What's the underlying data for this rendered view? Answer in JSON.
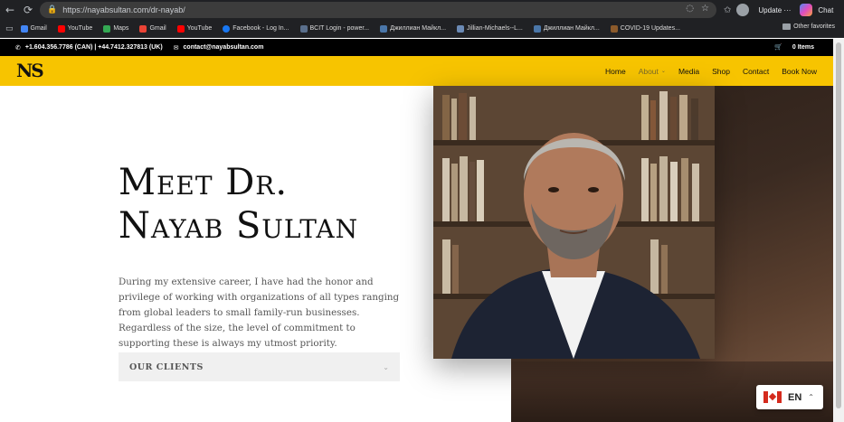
{
  "browser": {
    "url": "https://nayabsultan.com/dr-nayab/",
    "update_label": "Update",
    "chat_label": "Chat",
    "bookmarks": [
      {
        "label": "Gmail",
        "color": "#4285f4"
      },
      {
        "label": "YouTube",
        "color": "#ff0000"
      },
      {
        "label": "Maps",
        "color": "#34a853"
      },
      {
        "label": "Gmail",
        "color": "#ea4335"
      },
      {
        "label": "YouTube",
        "color": "#ff0000"
      },
      {
        "label": "Facebook - Log In...",
        "color": "#1877f2"
      },
      {
        "label": "BCIT Login - power...",
        "color": "#5a6f8c"
      },
      {
        "label": "Джиллиан Майкл...",
        "color": "#4a76a8"
      },
      {
        "label": "Jillian-Michaels--L...",
        "color": "#6b8ab5"
      },
      {
        "label": "Джиллиан Майкл...",
        "color": "#4a76a8"
      },
      {
        "label": "COVID-19 Updates...",
        "color": "#8b5a2b"
      }
    ],
    "other_favorites": "Other favorites"
  },
  "topbar": {
    "phone": "+1.604.356.7786 (CAN) | +44.7412.327813 (UK)",
    "email": "contact@nayabsultan.com",
    "cart": "0 Items"
  },
  "header": {
    "logo": "NS",
    "menu": [
      {
        "label": "Home"
      },
      {
        "label": "About"
      },
      {
        "label": "Media"
      },
      {
        "label": "Shop"
      },
      {
        "label": "Contact"
      },
      {
        "label": "Book Now"
      }
    ]
  },
  "hero": {
    "headline_line1": "Meet Dr.",
    "headline_line2": "Nayab Sultan",
    "body": "During my extensive career, I have had the honor and privilege of working with organizations of all types ranging from global leaders to small family-run businesses. Regardless of the size, the level of commitment to supporting these is always my utmost priority.",
    "clients_label": "OUR CLIENTS"
  },
  "language": {
    "code": "EN"
  },
  "colors": {
    "brand_yellow": "#f7c400",
    "topbar_black": "#000000",
    "browser_dark": "#202124"
  }
}
